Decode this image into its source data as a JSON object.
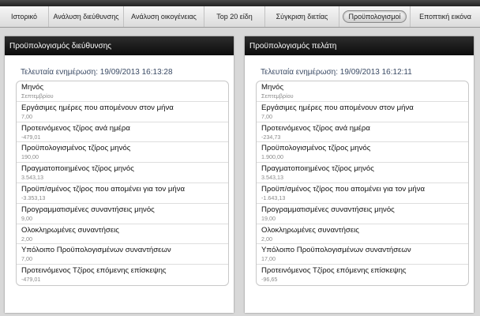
{
  "tabs": [
    {
      "label": "Ιστορικό",
      "active": false
    },
    {
      "label": "Ανάλυση διεύθυνσης",
      "active": false
    },
    {
      "label": "Ανάλυση οικογένειας",
      "active": false
    },
    {
      "label": "Top 20 είδη",
      "active": false
    },
    {
      "label": "Σύγκριση διετίας",
      "active": false
    },
    {
      "label": "Προϋπολογισμοί",
      "active": true
    },
    {
      "label": "Εποπτική εικόνα",
      "active": false
    }
  ],
  "left": {
    "title": "Προϋπολογισμός διεύθυνσης",
    "updated": "Τελευταία ενημέρωση: 19/09/2013 16:13:28",
    "rows": [
      {
        "label": "Μηνός",
        "value": "Σεπτεμβρίου"
      },
      {
        "label": "Εργάσιμες ημέρες που απομένουν στον μήνα",
        "value": "7,00"
      },
      {
        "label": "Προτεινόμενος τζίρος ανά ημέρα",
        "value": "-479,01"
      },
      {
        "label": "Προϋπολογισμένος τζίρος μηνός",
        "value": "190,00"
      },
      {
        "label": "Πραγματοποιημένος τζίρος μηνός",
        "value": "3.543,13"
      },
      {
        "label": "Προϋπ/σμένος τζίρος που απομένει για τον μήνα",
        "value": "-3.353,13"
      },
      {
        "label": "Προγραμματισμένες συναντήσεις μηνός",
        "value": "9,00"
      },
      {
        "label": "Ολοκληρωμένες συναντήσεις",
        "value": "2,00"
      },
      {
        "label": "Υπόλοιπο Προϋπολογισμένων συναντήσεων",
        "value": "7,00"
      },
      {
        "label": "Προτεινόμενος Τζίρος επόμενης επίσκεψης",
        "value": "-479,01"
      }
    ]
  },
  "right": {
    "title": "Προϋπολογισμός πελάτη",
    "updated": "Τελευταία ενημέρωση: 19/09/2013 16:12:11",
    "rows": [
      {
        "label": "Μηνός",
        "value": "Σεπτεμβρίου"
      },
      {
        "label": "Εργάσιμες ημέρες που απομένουν στον μήνα",
        "value": "7,00"
      },
      {
        "label": "Προτεινόμενος τζίρος ανά ημέρα",
        "value": "-234,73"
      },
      {
        "label": "Προϋπολογισμένος τζίρος μηνός",
        "value": "1.900,00"
      },
      {
        "label": "Πραγματοποιημένος τζίρος μηνός",
        "value": "3.543,13"
      },
      {
        "label": "Προϋπ/σμένος τζίρος που απομένει για τον μήνα",
        "value": "-1.643,13"
      },
      {
        "label": "Προγραμματισμένες συναντήσεις μηνός",
        "value": "19,00"
      },
      {
        "label": "Ολοκληρωμένες συναντήσεις",
        "value": "2,00"
      },
      {
        "label": "Υπόλοιπο Προϋπολογισμένων συναντήσεων",
        "value": "17,00"
      },
      {
        "label": "Προτεινόμενος Τζίρος επόμενης επίσκεψης",
        "value": "-96,65"
      }
    ]
  }
}
